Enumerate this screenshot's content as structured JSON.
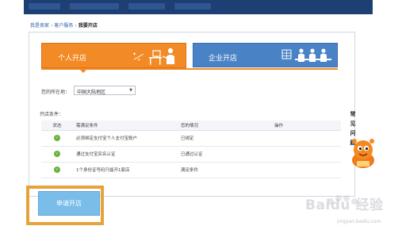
{
  "breadcrumb": {
    "home": "我是卖家",
    "section": "客户服务",
    "current": "我要开店"
  },
  "tabs": [
    {
      "label": "个人开店",
      "active": true,
      "color": "#f28a26"
    },
    {
      "label": "企业开店",
      "active": false,
      "color": "#4a82c6"
    }
  ],
  "location": {
    "label": "您的所在地：",
    "value": "中国大陆地区"
  },
  "conditions": {
    "label": "开店条件：",
    "headers": [
      "状态",
      "需满足条件",
      "您的情况",
      "操作"
    ],
    "rows": [
      {
        "condition": "必须绑定支付宝个人支付宝账户",
        "status": "已绑定",
        "action": ""
      },
      {
        "condition": "通过支付宝实名认证",
        "status": "已通过认证",
        "action": ""
      },
      {
        "condition": "1个身份证号码只能开1家店",
        "status": "满足条件",
        "action": ""
      }
    ]
  },
  "apply_button": "申请开店",
  "faq": "常见问题",
  "watermark": {
    "text": "Baidu 经验",
    "sub": "jingyan.baidu.com"
  }
}
